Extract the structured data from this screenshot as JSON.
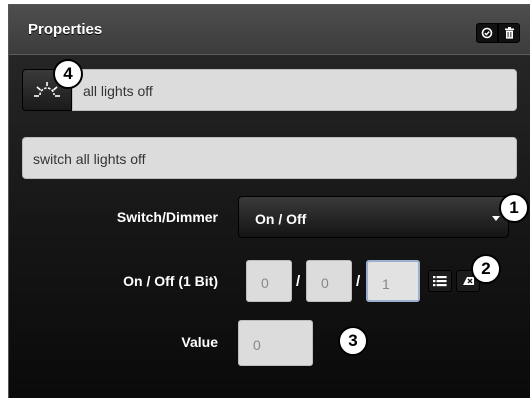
{
  "panel": {
    "title": "Properties",
    "header_buttons": [
      "check-circle-icon",
      "trash-icon"
    ]
  },
  "name": {
    "icon": "bulb-off-icon",
    "value": "all lights off"
  },
  "description": {
    "value": "switch all lights off"
  },
  "switch_dimmer": {
    "label": "Switch/Dimmer",
    "selected": "On / Off"
  },
  "group_address": {
    "label": "On / Off (1 Bit)",
    "main": "0",
    "middle": "0",
    "sub": "1",
    "separator": "/"
  },
  "value": {
    "label": "Value",
    "value": "0"
  },
  "callouts": [
    "1",
    "2",
    "3",
    "4"
  ],
  "colors": {
    "panel_bg": "#151515",
    "header_bg": "#454545",
    "field_bg": "#dcdcdc",
    "active_border": "#9ab0cc"
  }
}
